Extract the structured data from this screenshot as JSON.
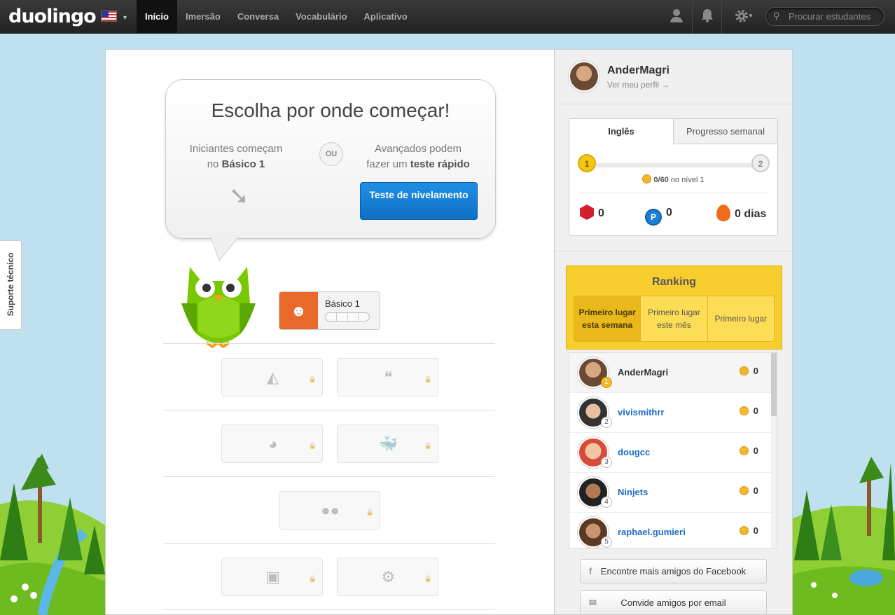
{
  "nav": {
    "logo": "duolingo",
    "items": [
      "Início",
      "Imersão",
      "Conversa",
      "Vocabulário",
      "Aplicativo"
    ],
    "search_placeholder": "Procurar estudantes"
  },
  "support": "Suporte técnico",
  "bubble": {
    "title": "Escolha por onde começar!",
    "left_line1": "Iniciantes começam",
    "left_prefix": "no",
    "left_bold": "Básico 1",
    "or": "OU",
    "right_line1": "Avançados podem",
    "right_prefix": "fazer um",
    "right_bold": "teste rápido",
    "button": "Teste de nivelamento"
  },
  "skill_active": "Básico 1",
  "profile": {
    "name": "AnderMagri",
    "link": "Ver meu perfil →"
  },
  "progress": {
    "tab_active": "Inglês",
    "tab_other": "Progresso semanal",
    "level_from": "1",
    "level_to": "2",
    "xp_value": "0/60",
    "xp_suffix": "no nível 1",
    "progress_fraction": 0,
    "gems": "0",
    "points": "0",
    "streak": "0 dias"
  },
  "ranking": {
    "title": "Ranking",
    "tabs": [
      "Primeiro lugar esta semana",
      "Primeiro lugar este mês",
      "Primeiro lugar"
    ],
    "entries": [
      {
        "rank": "1",
        "name": "AnderMagri",
        "points": "0"
      },
      {
        "rank": "2",
        "name": "vivismithrr",
        "points": "0"
      },
      {
        "rank": "3",
        "name": "dougcc",
        "points": "0"
      },
      {
        "rank": "4",
        "name": "Ninjets",
        "points": "0"
      },
      {
        "rank": "5",
        "name": "raphael.gumieri",
        "points": "0"
      }
    ]
  },
  "buttons": {
    "facebook": "Encontre mais amigos do Facebook",
    "email": "Convide amigos por email"
  },
  "colors": {
    "accent_blue": "#1a7fd8",
    "owl_green": "#78c800",
    "ranking_gold": "#f8cd2e",
    "skill_orange": "#e8692a"
  }
}
